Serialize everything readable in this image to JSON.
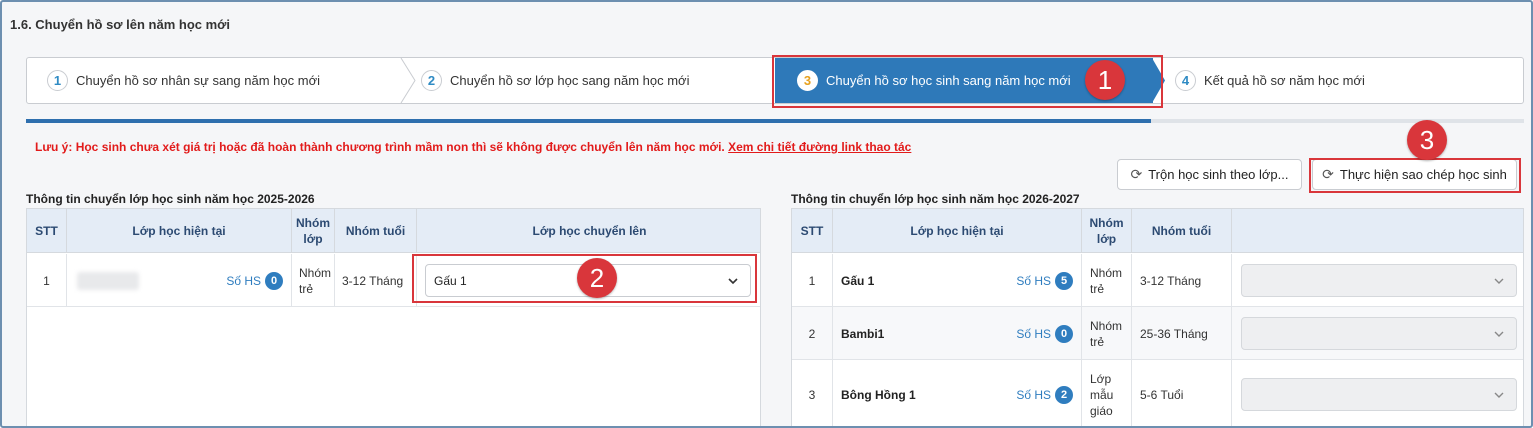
{
  "page": {
    "title": "1.6. Chuyển hồ sơ lên năm học mới"
  },
  "wizard": {
    "steps": [
      {
        "num": "1",
        "label": "Chuyển hồ sơ nhân sự sang năm học mới"
      },
      {
        "num": "2",
        "label": "Chuyển hồ sơ lớp học sang năm học mới"
      },
      {
        "num": "3",
        "label": "Chuyển hồ sơ học sinh sang năm học mới"
      },
      {
        "num": "4",
        "label": "Kết quả hồ sơ năm học mới"
      }
    ],
    "active_step": 3
  },
  "annotations": [
    "1",
    "2",
    "3"
  ],
  "notice": {
    "text": "Lưu ý: Học sinh chưa xét giá trị hoặc đã hoàn thành chương trình mầm non thì sẽ không được chuyển lên năm học mới.",
    "link": "Xem chi tiết đường link thao tác"
  },
  "toolbar": {
    "merge_button": "Trộn học sinh theo lớp...",
    "copy_button": "Thực hiện sao chép học sinh"
  },
  "left_table": {
    "caption": "Thông tin chuyển lớp học sinh năm học 2025-2026",
    "headers": [
      "STT",
      "Lớp học hiện tại",
      "Nhóm lớp",
      "Nhóm tuổi",
      "Lớp học chuyển lên"
    ],
    "rows": [
      {
        "stt": "1",
        "class_name": "",
        "hs_label": "Số HS",
        "hs_count": "0",
        "group": "Nhóm trẻ",
        "age": "3-12 Tháng",
        "target": "Gấu 1"
      }
    ]
  },
  "right_table": {
    "caption": "Thông tin chuyển lớp học sinh năm học 2026-2027",
    "headers": [
      "STT",
      "Lớp học hiện tại",
      "Nhóm lớp",
      "Nhóm tuổi",
      ""
    ],
    "rows": [
      {
        "stt": "1",
        "class_name": "Gấu 1",
        "hs_label": "Số HS",
        "hs_count": "5",
        "group": "Nhóm trẻ",
        "age": "3-12 Tháng",
        "target": ""
      },
      {
        "stt": "2",
        "class_name": "Bambi1",
        "hs_label": "Số HS",
        "hs_count": "0",
        "group": "Nhóm trẻ",
        "age": "25-36 Tháng",
        "target": ""
      },
      {
        "stt": "3",
        "class_name": "Bông Hồng 1",
        "hs_label": "Số HS",
        "hs_count": "2",
        "group": "Lớp mẫu giáo",
        "age": "5-6 Tuổi",
        "target": ""
      }
    ]
  },
  "colors": {
    "accent": "#2e79b9",
    "highlight": "#d9363b",
    "notice": "#e21b1b"
  },
  "icons": {
    "refresh": "refresh-icon",
    "chevron": "chevron-down-icon"
  }
}
